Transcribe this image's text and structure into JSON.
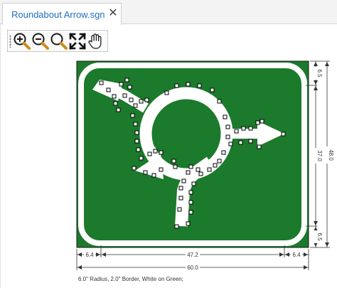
{
  "tabs": [
    {
      "label": "Roundabout Arrow.sgn",
      "close": "✕"
    }
  ],
  "toolbar": {
    "buttons": [
      {
        "icon": "zoom-in-icon"
      },
      {
        "icon": "zoom-out-icon"
      },
      {
        "icon": "zoom-fit-icon"
      },
      {
        "icon": "fullscreen-icon"
      },
      {
        "icon": "pan-hand-icon"
      }
    ]
  },
  "sign": {
    "background_color": "#1b7a2b",
    "border_color": "#ffffff",
    "legend_color": "#ffffff",
    "dimensions": {
      "top_margin": "6.5",
      "legend_height": "37.0",
      "bottom_margin": "6.5",
      "total_height": "48.0",
      "left_margin": "6.4",
      "legend_width": "47.2",
      "right_margin": "6.4",
      "total_width": "60.0"
    },
    "caption": "6.0\" Radius, 2.0\" Border, White on Green;"
  }
}
